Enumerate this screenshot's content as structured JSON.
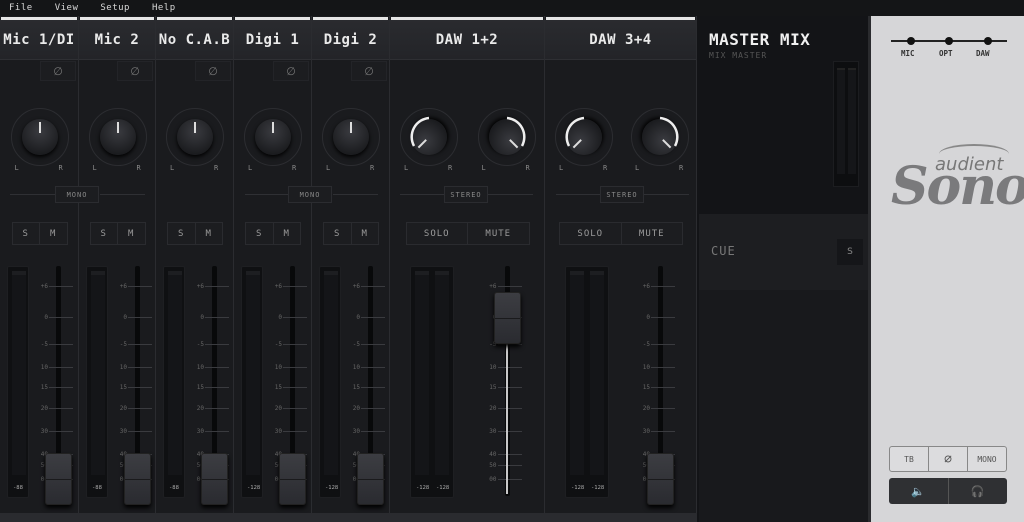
{
  "menu": [
    "File",
    "View",
    "Setup",
    "Help"
  ],
  "phase_symbol": "∅",
  "pan_labels": {
    "left": "L",
    "right": "R"
  },
  "channels": [
    {
      "name": "Mic 1/DI",
      "solo": "S",
      "mute": "M",
      "meter_values": [
        "-88"
      ],
      "pan": 0.5,
      "fader_db": "-inf"
    },
    {
      "name": "Mic 2",
      "solo": "S",
      "mute": "M",
      "meter_values": [
        "-88"
      ],
      "pan": 0.5,
      "fader_db": "-inf"
    },
    {
      "name": "No C.A.B",
      "solo": "S",
      "mute": "M",
      "meter_values": [
        "-88"
      ],
      "pan": 0.5,
      "fader_db": "-inf"
    },
    {
      "name": "Digi 1",
      "solo": "S",
      "mute": "M",
      "meter_values": [
        "-128"
      ],
      "pan": 0.5,
      "fader_db": "-inf"
    },
    {
      "name": "Digi 2",
      "solo": "S",
      "mute": "M",
      "meter_values": [
        "-128"
      ],
      "pan": 0.5,
      "fader_db": "-inf"
    },
    {
      "name": "DAW 1+2",
      "solo": "SOLO",
      "mute": "MUTE",
      "meter_values": [
        "-128",
        "-128"
      ],
      "pan_left": 0,
      "pan_right": 1,
      "fader_db": "0"
    },
    {
      "name": "DAW 3+4",
      "solo": "SOLO",
      "mute": "MUTE",
      "meter_values": [
        "-128",
        "-128"
      ],
      "pan_left": 0,
      "pan_right": 1,
      "fader_db": "-inf"
    }
  ],
  "links": {
    "mono_1": "MONO",
    "mono_2": "MONO",
    "stereo_1": "STEREO",
    "stereo_2": "STEREO"
  },
  "scale": [
    "+6",
    "0",
    "-5",
    "10",
    "15",
    "20",
    "30",
    "40",
    "50",
    "00"
  ],
  "master": {
    "title": "MASTER MIX",
    "subtitle": "MIX MASTER",
    "cue_label": "CUE",
    "cue_solo": "S"
  },
  "side": {
    "routing": [
      "MIC",
      "OPT",
      "DAW"
    ],
    "brand_top": "audient",
    "brand_main": "Sono",
    "buttons": {
      "talkback": "TB",
      "phase": "∅",
      "mono": "MONO",
      "speaker": "🔈",
      "headphones": "🎧"
    }
  }
}
